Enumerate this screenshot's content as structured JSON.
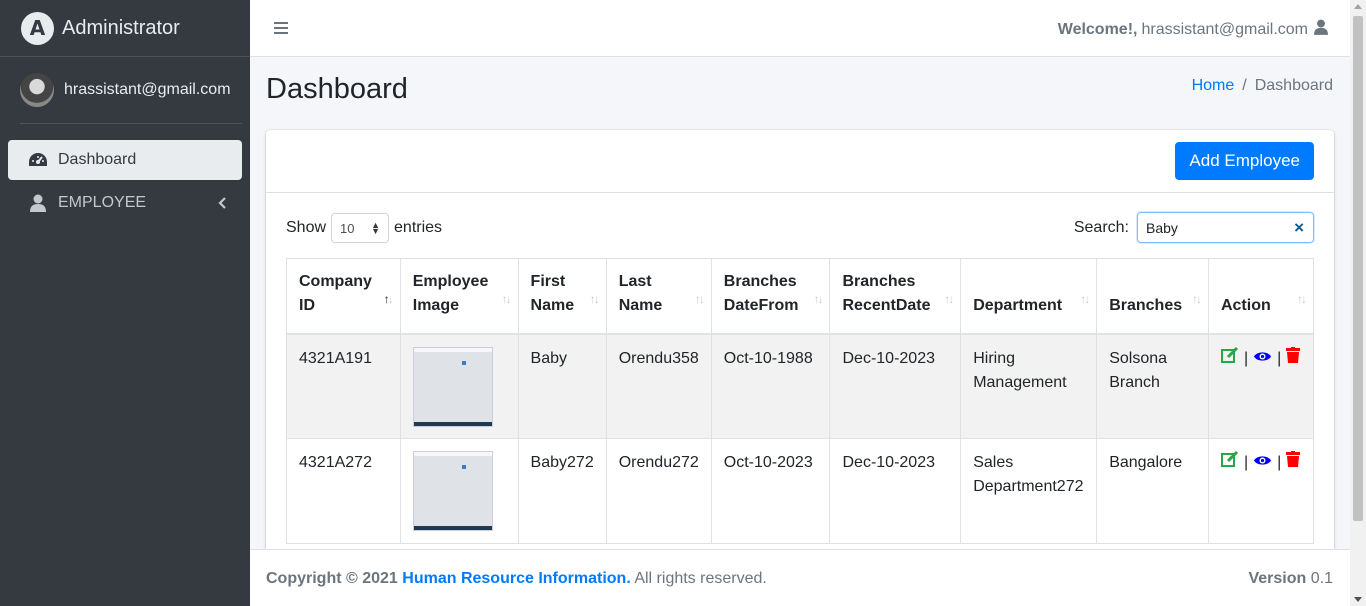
{
  "sidebar": {
    "brand": "Administrator",
    "brand_letter": "A",
    "user": "hrassistant@gmail.com",
    "items": [
      {
        "label": "Dashboard",
        "icon": "tachometer-icon"
      },
      {
        "label": "EMPLOYEE",
        "icon": "user-icon"
      }
    ]
  },
  "topbar": {
    "welcome": "Welcome!,",
    "email": "hrassistant@gmail.com"
  },
  "header": {
    "title": "Dashboard",
    "breadcrumb": [
      "Home",
      "Dashboard"
    ],
    "breadcrumb_sep": "/"
  },
  "card": {
    "add_button": "Add Employee",
    "show_label": "Show",
    "entries_label": "entries",
    "page_length": "10",
    "search_label": "Search:",
    "search_value": "Baby"
  },
  "table": {
    "columns": [
      [
        "Company",
        "ID"
      ],
      [
        "Employee",
        "Image"
      ],
      [
        "First",
        "Name"
      ],
      [
        "Last",
        "Name"
      ],
      [
        "Branches",
        "DateFrom"
      ],
      [
        "Branches",
        "RecentDate"
      ],
      [
        "Department",
        ""
      ],
      [
        "Branches",
        ""
      ],
      [
        "Action",
        ""
      ]
    ],
    "rows": [
      {
        "company_id": "4321A191",
        "first": "Baby",
        "last": "Orendu358",
        "from": "Oct-10-1988",
        "recent": "Dec-10-2023",
        "dept1": "Hiring",
        "dept2": "Management",
        "branch1": "Solsona",
        "branch2": "Branch"
      },
      {
        "company_id": "4321A272",
        "first": "Baby272",
        "last": "Orendu272",
        "from": "Oct-10-2023",
        "recent": "Dec-10-2023",
        "dept1": "Sales",
        "dept2": "Department272",
        "branch1": "Bangalore",
        "branch2": ""
      }
    ]
  },
  "footer": {
    "copyright": "Copyright © 2021",
    "org": "Human Resource Information.",
    "rights": "All rights reserved.",
    "version_label": "Version",
    "version": "0.1"
  },
  "colors": {
    "sidebar_bg": "#343a40",
    "primary": "#007bff",
    "edit": "#28a745",
    "view": "#0000ff",
    "delete": "#ff0000"
  }
}
